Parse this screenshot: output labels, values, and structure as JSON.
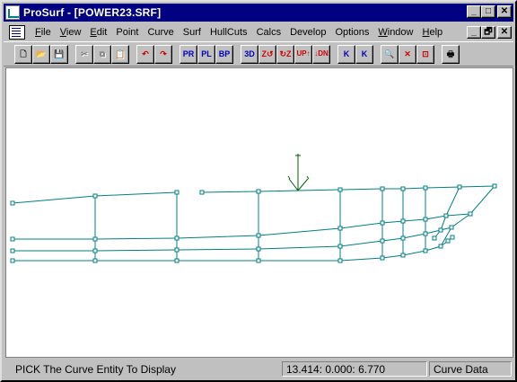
{
  "window": {
    "title": "ProSurf - [POWER23.SRF]",
    "caption_buttons": [
      "_",
      "□",
      "✕"
    ]
  },
  "menubar": {
    "items": [
      {
        "label": "File",
        "accel": "F"
      },
      {
        "label": "View",
        "accel": "V"
      },
      {
        "label": "Edit",
        "accel": "E"
      },
      {
        "label": "Point",
        "accel": ""
      },
      {
        "label": "Curve",
        "accel": ""
      },
      {
        "label": "Surf",
        "accel": ""
      },
      {
        "label": "HullCuts",
        "accel": ""
      },
      {
        "label": "Calcs",
        "accel": ""
      },
      {
        "label": "Develop",
        "accel": ""
      },
      {
        "label": "Options",
        "accel": ""
      },
      {
        "label": "Window",
        "accel": "W"
      },
      {
        "label": "Help",
        "accel": "H"
      }
    ],
    "mdi_buttons": [
      "_",
      "🗗",
      "✕"
    ]
  },
  "toolbar": {
    "groups": [
      [
        {
          "name": "new-doc",
          "icon": "new-document-icon",
          "glyph": "🗋",
          "enabled": true
        },
        {
          "name": "open",
          "icon": "open-folder-icon",
          "glyph": "📂",
          "enabled": true
        },
        {
          "name": "save",
          "icon": "save-disk-icon",
          "glyph": "💾",
          "enabled": true
        }
      ],
      [
        {
          "name": "cut",
          "icon": "scissors-icon",
          "glyph": "✂",
          "enabled": false
        },
        {
          "name": "copy",
          "icon": "copy-icon",
          "glyph": "⧉",
          "enabled": false
        },
        {
          "name": "paste",
          "icon": "paste-icon",
          "glyph": "📋",
          "enabled": false
        }
      ],
      [
        {
          "name": "undo",
          "icon": "undo-arrow-icon",
          "glyph": "↶",
          "enabled": true,
          "color": "red"
        },
        {
          "name": "redo",
          "icon": "redo-arrow-icon",
          "glyph": "↷",
          "enabled": true,
          "color": "red"
        }
      ],
      [
        {
          "name": "view-pr",
          "icon": "profile-view-icon",
          "glyph": "PR",
          "enabled": true,
          "color": "blue"
        },
        {
          "name": "view-pl",
          "icon": "plan-view-icon",
          "glyph": "PL",
          "enabled": true,
          "color": "blue"
        },
        {
          "name": "view-bp",
          "icon": "body-plan-view-icon",
          "glyph": "BP",
          "enabled": true,
          "color": "blue"
        }
      ],
      [
        {
          "name": "view-3d",
          "icon": "3d-view-icon",
          "glyph": "3D",
          "enabled": true,
          "color": "blue"
        },
        {
          "name": "rotate-z-ccw",
          "icon": "rotate-z-icon",
          "glyph": "Z↺",
          "enabled": true,
          "color": "red"
        },
        {
          "name": "rotate-z-cw",
          "icon": "rotate-z-cw-icon",
          "glyph": "↻Z",
          "enabled": true,
          "color": "red"
        },
        {
          "name": "view-up",
          "icon": "up-arrow-icon",
          "glyph": "UP↑",
          "enabled": true,
          "color": "red"
        },
        {
          "name": "view-dn",
          "icon": "down-arrow-icon",
          "glyph": "↓DN",
          "enabled": true,
          "color": "red"
        }
      ],
      [
        {
          "name": "knuckle-down",
          "icon": "knuckle-k-icon",
          "glyph": "K",
          "enabled": true,
          "color": "blue"
        },
        {
          "name": "knuckle-up",
          "icon": "knuckle-k-up-icon",
          "glyph": "K",
          "enabled": true,
          "color": "blue"
        }
      ],
      [
        {
          "name": "zoom",
          "icon": "magnifier-icon",
          "glyph": "🔍",
          "enabled": true,
          "color": "red"
        },
        {
          "name": "zoom-out",
          "icon": "zoom-cancel-icon",
          "glyph": "✕",
          "enabled": true,
          "color": "red"
        },
        {
          "name": "zoom-region",
          "icon": "zoom-region-icon",
          "glyph": "⊡",
          "enabled": true,
          "color": "red"
        }
      ],
      [
        {
          "name": "print",
          "icon": "printer-icon",
          "glyph": "🖶",
          "enabled": true
        }
      ]
    ]
  },
  "drawing": {
    "line_color": "#008080",
    "axis_color": "#006000",
    "marker_fill": "#ffffff"
  },
  "statusbar": {
    "message": "PICK The Curve Entity To Display",
    "coords": "13.414:  0.000:  6.770",
    "mode": "Curve Data"
  }
}
